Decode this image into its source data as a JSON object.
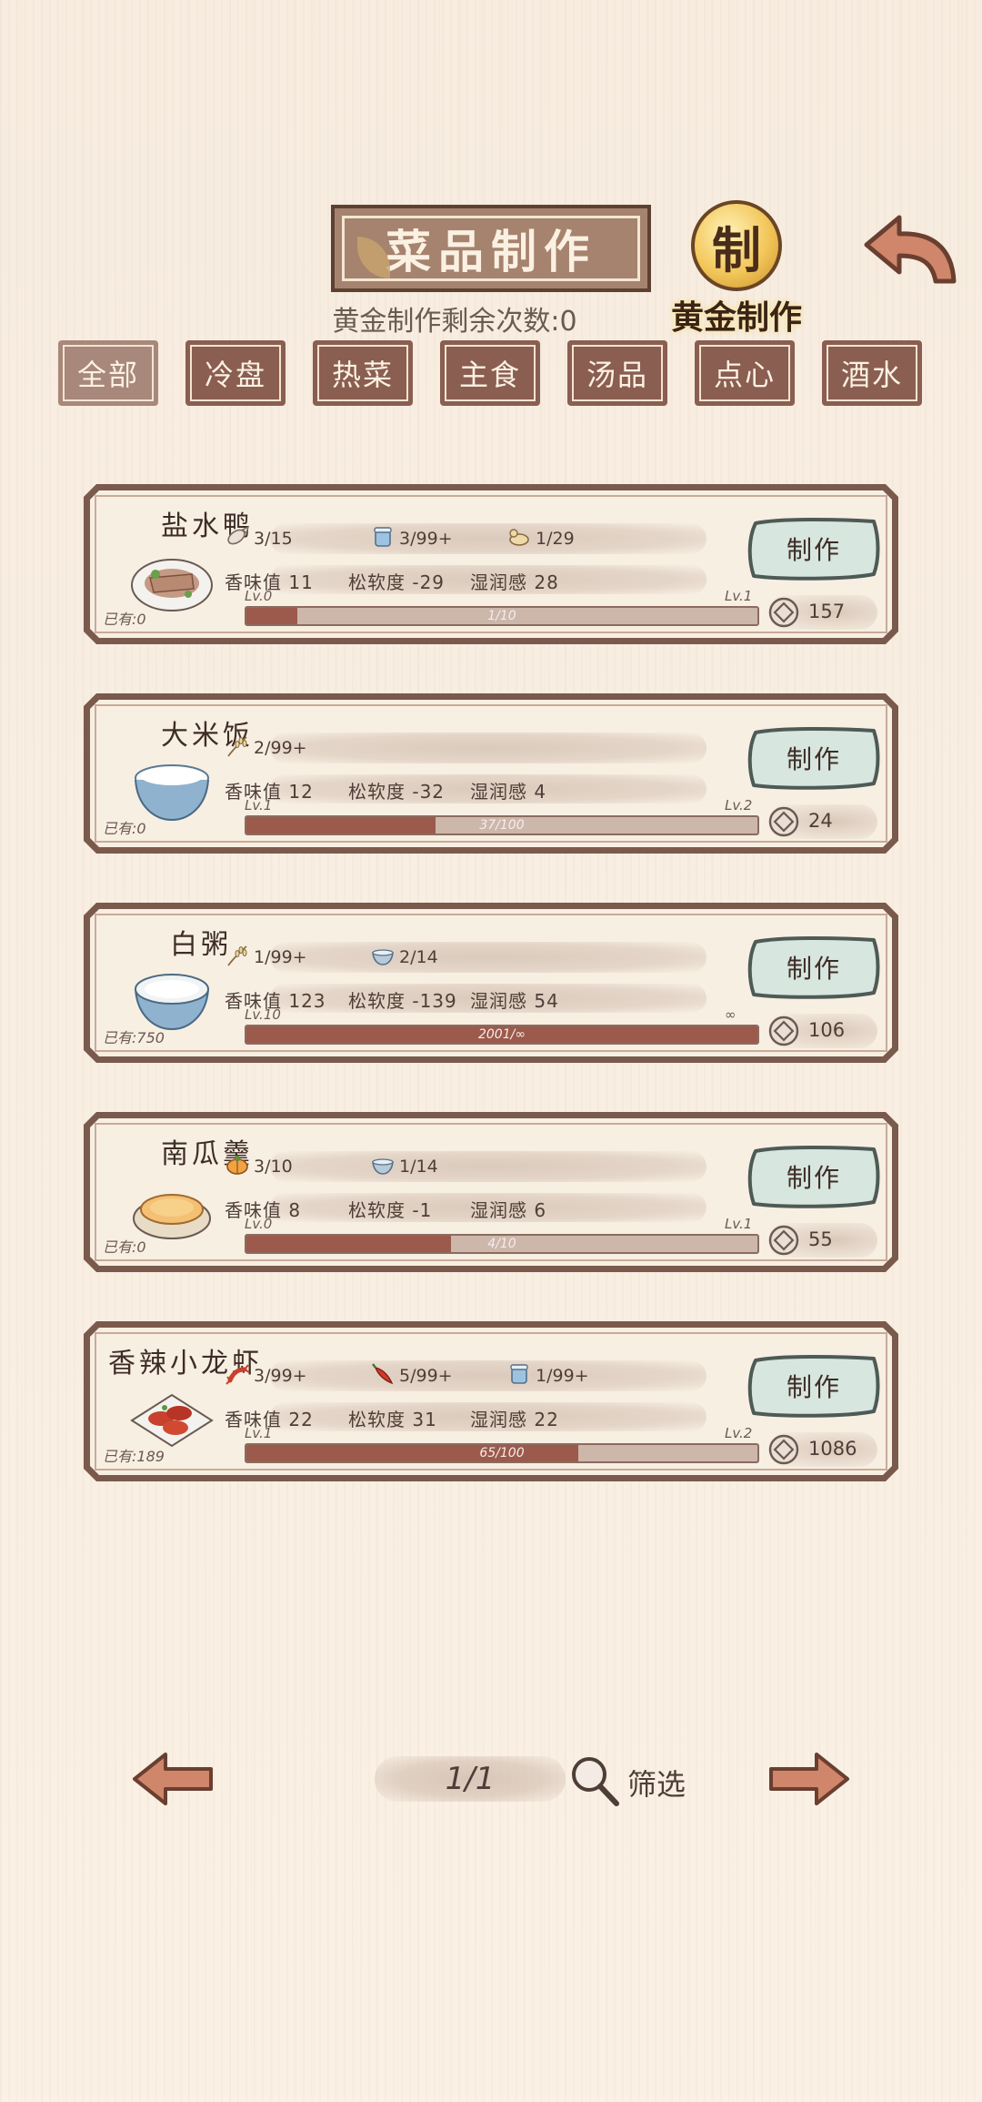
{
  "header": {
    "title": "菜品制作",
    "gold_remaining": "黄金制作剩余次数:0",
    "gold_button_label": "黄金制作",
    "gold_coin_glyph": "制"
  },
  "tabs": [
    {
      "label": "全部",
      "active": true
    },
    {
      "label": "冷盘",
      "active": false
    },
    {
      "label": "热菜",
      "active": false
    },
    {
      "label": "主食",
      "active": false
    },
    {
      "label": "汤品",
      "active": false
    },
    {
      "label": "点心",
      "active": false
    },
    {
      "label": "酒水",
      "active": false
    }
  ],
  "dishes": [
    {
      "name": "盐水鸭",
      "icon": "salted-duck-icon",
      "owned": "已有:0",
      "ingredients": [
        {
          "icon": "fish-icon",
          "amount": "3/15"
        },
        {
          "icon": "salt-jar-icon",
          "amount": "3/99+"
        },
        {
          "icon": "duck-icon",
          "amount": "1/29"
        }
      ],
      "stats": {
        "aroma": "香味值 11",
        "softness": "松软度 -29",
        "moisture": "湿润感 28"
      },
      "level_left": "Lv.0",
      "level_right": "Lv.1",
      "progress_text": "1/10",
      "progress": 0.1,
      "make_label": "制作",
      "cost": "157"
    },
    {
      "name": "大米饭",
      "icon": "rice-bowl-icon",
      "owned": "已有:0",
      "ingredients": [
        {
          "icon": "rice-stalk-icon",
          "amount": "2/99+"
        }
      ],
      "stats": {
        "aroma": "香味值 12",
        "softness": "松软度 -32",
        "moisture": "湿润感 4"
      },
      "level_left": "Lv.1",
      "level_right": "Lv.2",
      "progress_text": "37/100",
      "progress": 0.37,
      "make_label": "制作",
      "cost": "24"
    },
    {
      "name": "白粥",
      "icon": "congee-bowl-icon",
      "owned": "已有:750",
      "ingredients": [
        {
          "icon": "rice-stalk-icon",
          "amount": "1/99+"
        },
        {
          "icon": "bowl-icon",
          "amount": "2/14"
        }
      ],
      "stats": {
        "aroma": "香味值 123",
        "softness": "松软度 -139",
        "moisture": "湿润感 54"
      },
      "level_left": "Lv.10",
      "level_right": "∞",
      "progress_text": "2001/∞",
      "progress": 1.0,
      "make_label": "制作",
      "cost": "106"
    },
    {
      "name": "南瓜羹",
      "icon": "pumpkin-soup-icon",
      "owned": "已有:0",
      "ingredients": [
        {
          "icon": "pumpkin-icon",
          "amount": "3/10"
        },
        {
          "icon": "bowl-icon",
          "amount": "1/14"
        }
      ],
      "stats": {
        "aroma": "香味值 8",
        "softness": "松软度 -1",
        "moisture": "湿润感 6"
      },
      "level_left": "Lv.0",
      "level_right": "Lv.1",
      "progress_text": "4/10",
      "progress": 0.4,
      "make_label": "制作",
      "cost": "55"
    },
    {
      "name": "香辣小龙虾",
      "icon": "crayfish-plate-icon",
      "owned": "已有:189",
      "ingredients": [
        {
          "icon": "crayfish-icon",
          "amount": "3/99+"
        },
        {
          "icon": "chili-icon",
          "amount": "5/99+"
        },
        {
          "icon": "salt-jar-icon",
          "amount": "1/99+"
        }
      ],
      "stats": {
        "aroma": "香味值 22",
        "softness": "松软度 31",
        "moisture": "湿润感 22"
      },
      "level_left": "Lv.1",
      "level_right": "Lv.2",
      "progress_text": "65/100",
      "progress": 0.65,
      "make_label": "制作",
      "cost": "1086"
    }
  ],
  "footer": {
    "page": "1/1",
    "filter_label": "筛选"
  },
  "colors": {
    "frame": "#7a5a4c",
    "make_button": "#d7e6df",
    "progress_fill": "#9b5a4b",
    "gold": "#f2c659"
  }
}
